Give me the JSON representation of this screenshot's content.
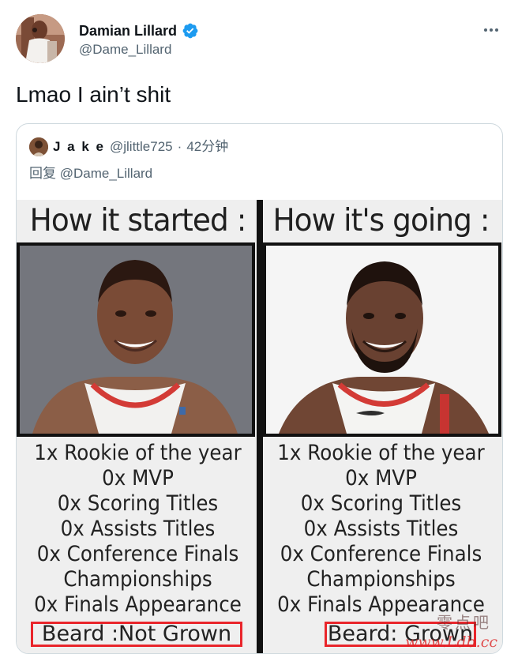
{
  "tweet": {
    "author": {
      "display_name": "Damian Lillard",
      "handle": "@Dame_Lillard",
      "verified_icon": "verified-badge-icon",
      "avatar_icon": "avatar"
    },
    "more_icon": "more-options-icon",
    "text": "Lmao I ain’t shit"
  },
  "quote": {
    "author": {
      "display_name": "J a k e",
      "handle": "@jlittle725",
      "separator": "·",
      "time": "42分钟"
    },
    "reply_to": "回复 @Dame_Lillard",
    "meme": {
      "left": {
        "title": "How it started :",
        "stats": [
          "1x Rookie of the year",
          "0x MVP",
          "0x Scoring Titles",
          "0x Assists Titles",
          "0x Conference Finals",
          "Championships",
          "0x Finals Appearance"
        ],
        "beard": "Beard :Not Grown"
      },
      "right": {
        "title": "How it's going :",
        "stats": [
          "1x Rookie of the year",
          "0x MVP",
          "0x Scoring Titles",
          "0x Assists Titles",
          "0x Conference Finals",
          "Championships",
          "0x Finals Appearance"
        ],
        "beard": "Beard: Grown"
      },
      "watermark": {
        "top": "零点吧",
        "bottom": "www.Ldb.cc"
      }
    }
  },
  "colors": {
    "text": "#0f1419",
    "secondary": "#536471",
    "verified": "#1d9bf0",
    "border": "#cfd9de",
    "highlight_box": "#e9252b"
  }
}
